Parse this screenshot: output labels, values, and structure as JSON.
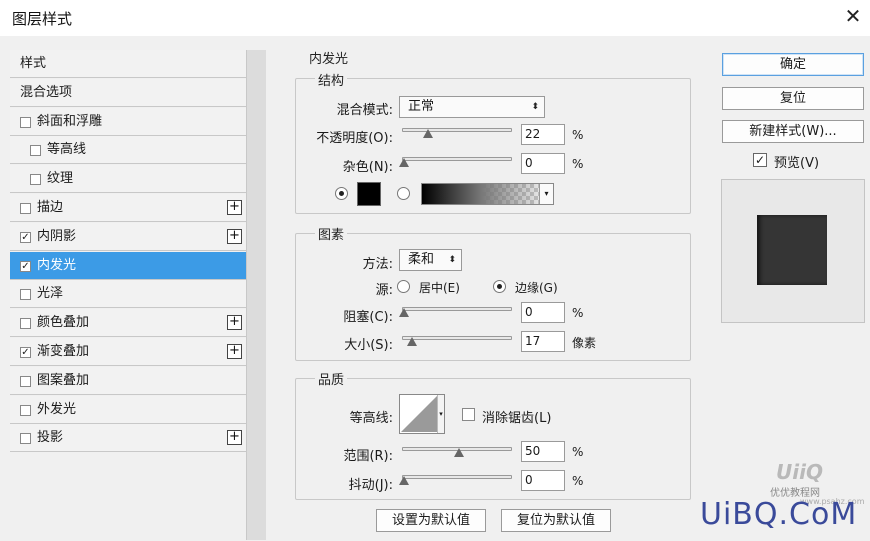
{
  "window": {
    "title": "图层样式",
    "close_icon": "close-icon"
  },
  "style_list": [
    {
      "label": "样式",
      "checkbox": false,
      "plus": false,
      "indent": false,
      "selected": false
    },
    {
      "label": "混合选项",
      "checkbox": false,
      "plus": false,
      "indent": false,
      "selected": false
    },
    {
      "label": "斜面和浮雕",
      "checkbox": true,
      "checked": false,
      "plus": false,
      "indent": false,
      "selected": false
    },
    {
      "label": "等高线",
      "checkbox": true,
      "checked": false,
      "plus": false,
      "indent": true,
      "selected": false
    },
    {
      "label": "纹理",
      "checkbox": true,
      "checked": false,
      "plus": false,
      "indent": true,
      "selected": false
    },
    {
      "label": "描边",
      "checkbox": true,
      "checked": false,
      "plus": true,
      "indent": false,
      "selected": false
    },
    {
      "label": "内阴影",
      "checkbox": true,
      "checked": true,
      "plus": true,
      "indent": false,
      "selected": false
    },
    {
      "label": "内发光",
      "checkbox": true,
      "checked": true,
      "plus": false,
      "indent": false,
      "selected": true
    },
    {
      "label": "光泽",
      "checkbox": true,
      "checked": false,
      "plus": false,
      "indent": false,
      "selected": false
    },
    {
      "label": "颜色叠加",
      "checkbox": true,
      "checked": false,
      "plus": true,
      "indent": false,
      "selected": false
    },
    {
      "label": "渐变叠加",
      "checkbox": true,
      "checked": true,
      "plus": true,
      "indent": false,
      "selected": false
    },
    {
      "label": "图案叠加",
      "checkbox": true,
      "checked": false,
      "plus": false,
      "indent": false,
      "selected": false
    },
    {
      "label": "外发光",
      "checkbox": true,
      "checked": false,
      "plus": false,
      "indent": false,
      "selected": false
    },
    {
      "label": "投影",
      "checkbox": true,
      "checked": false,
      "plus": true,
      "indent": false,
      "selected": false
    }
  ],
  "panel": {
    "title": "内发光",
    "structure": {
      "title": "结构",
      "blend_mode_label": "混合模式:",
      "blend_mode_value": "正常",
      "opacity_label": "不透明度(O):",
      "opacity_value": "22",
      "opacity_unit": "%",
      "opacity_level": 22,
      "noise_label": "杂色(N):",
      "noise_value": "0",
      "noise_unit": "%",
      "noise_level": 0,
      "color_swatch": "#000000"
    },
    "elements": {
      "title": "图素",
      "method_label": "方法:",
      "method_value": "柔和",
      "source_label": "源:",
      "source_center": "居中(E)",
      "source_edge": "边缘(G)",
      "choke_label": "阻塞(C):",
      "choke_value": "0",
      "choke_unit": "%",
      "choke_level": 0,
      "size_label": "大小(S):",
      "size_value": "17",
      "size_unit": "像素",
      "size_level": 7
    },
    "quality": {
      "title": "品质",
      "contour_label": "等高线:",
      "antialias_label": "消除锯齿(L)",
      "range_label": "范围(R):",
      "range_value": "50",
      "range_unit": "%",
      "range_level": 50,
      "jitter_label": "抖动(J):",
      "jitter_value": "0",
      "jitter_unit": "%",
      "jitter_level": 0
    },
    "set_default": "设置为默认值",
    "reset_default": "复位为默认值"
  },
  "actions": {
    "ok": "确定",
    "reset": "复位",
    "new_style": "新建样式(W)...",
    "preview_label": "预览(V)",
    "preview_checked": true
  },
  "watermark": {
    "main": "UiBQ.CoM",
    "sub": "优优教程网",
    "site": "www.psahz.com"
  }
}
